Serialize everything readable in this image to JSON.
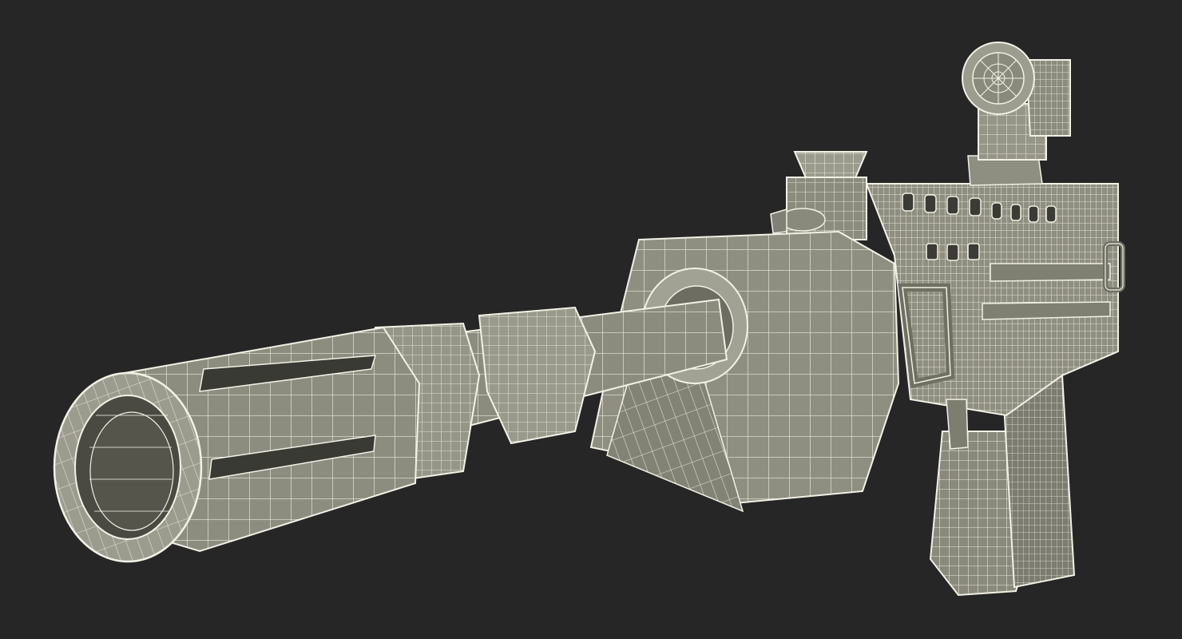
{
  "scene": {
    "subject": "wireframe-rifle-render",
    "colors": {
      "background": "#262626",
      "surface": "#8a8a7c",
      "surface_light": "#a3a395",
      "surface_dark": "#707063",
      "cavity": "#4a4a42",
      "wire": "#f3f1e6"
    }
  }
}
